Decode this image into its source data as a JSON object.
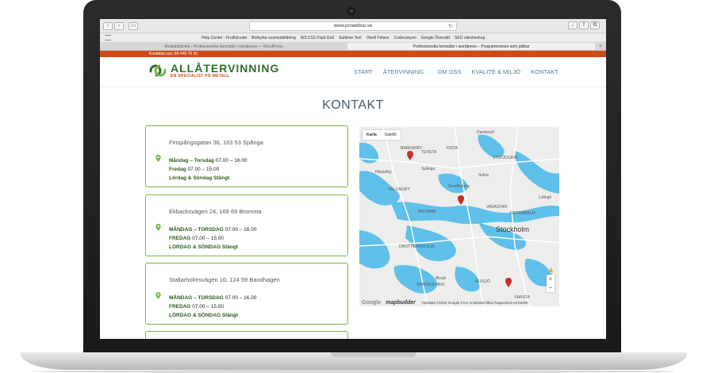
{
  "browser": {
    "url": "www.prowebso.se",
    "bookmarks": [
      "Help Center - Fruitfulcode",
      "Botkyrka vuxenutbildning",
      "W3.CSS Fluid Grid",
      "Sublime Text",
      "Okelli Frilans",
      "Codecanyon",
      "Google Översätt",
      "SEO sitecheckup"
    ],
    "tabs": [
      {
        "label": "Mediabibliotek ‹ Professionella hemsidor i wordpress — WordPress",
        "active": false
      },
      {
        "label": "Professionella hemsidor i wordpress – Programmerare som jobbar",
        "active": true
      }
    ]
  },
  "site": {
    "topbar_text": "Kontakta oss: 08-445 76 50",
    "logo_name": "ALLÅTERVINNING",
    "logo_sub": "EN SPECIALIST PÅ METALL",
    "nav": [
      "START",
      "ÅTERVINNING ·",
      "OM OSS",
      "KVALITÉ & MILJÖ",
      "KONTAKT"
    ],
    "page_title": "KONTAKT",
    "locations": [
      {
        "address": "Finspångsgatan 36, 163 53 Spånga",
        "days1": "Måndag – Torsdag",
        "hours1": "07.00 – 16.00",
        "days2": "Fredag",
        "hours2": "07.00 – 15.00",
        "days3": "Lördag & Söndag",
        "hours3": "Stängt"
      },
      {
        "address": "Ekbacksvägen 24, 168 69 Bromma",
        "days1": "MÅNDAG – TORSDAG",
        "hours1": "07.00 – 16.00",
        "days2": "FREDAG",
        "hours2": "07.00 – 15.00",
        "days3": "LÖRDAG & SÖNDAG",
        "hours3": "Stängt"
      },
      {
        "address": "Stallarholmsvägen 10, 124 59 Bandhagen",
        "days1": "MÅNDAG – TORSDAG",
        "hours1": "07.00 – 16.00",
        "days2": "FREDAG",
        "hours2": "07.00 – 15.00",
        "days3": "LÖRDAG & SÖNDAG",
        "hours3": "Stängt"
      }
    ],
    "map": {
      "toggle": [
        "Karta",
        "Satellit"
      ],
      "labels": [
        "Danderyd",
        "KISTA",
        "TENSTA",
        "Spånga",
        "Solna",
        "Sundbyberg",
        "VASASTAN",
        "ÖSTERMALM",
        "Stockholm",
        "Älvsjö",
        "SKÄRHOLMEN",
        "FARSTA",
        "VÄLLINGBY",
        "BROMMA",
        "Hässelby",
        "Lidingö",
        "ÄLVSJÖ",
        "BARKARBY",
        "STOCKSUND",
        "DROTTNINGHOLM"
      ],
      "google": "Google",
      "builder": "mapbuilder",
      "credit": "Kartdata ©2016 Google   2 km   Användarvillkor   Rapportera ett kartfel"
    }
  },
  "colors": {
    "accent": "#d14a12",
    "brand_green": "#2f6f2c",
    "card_border": "#7ab648",
    "water": "#5fc0ea",
    "pin": "#c5302b"
  }
}
